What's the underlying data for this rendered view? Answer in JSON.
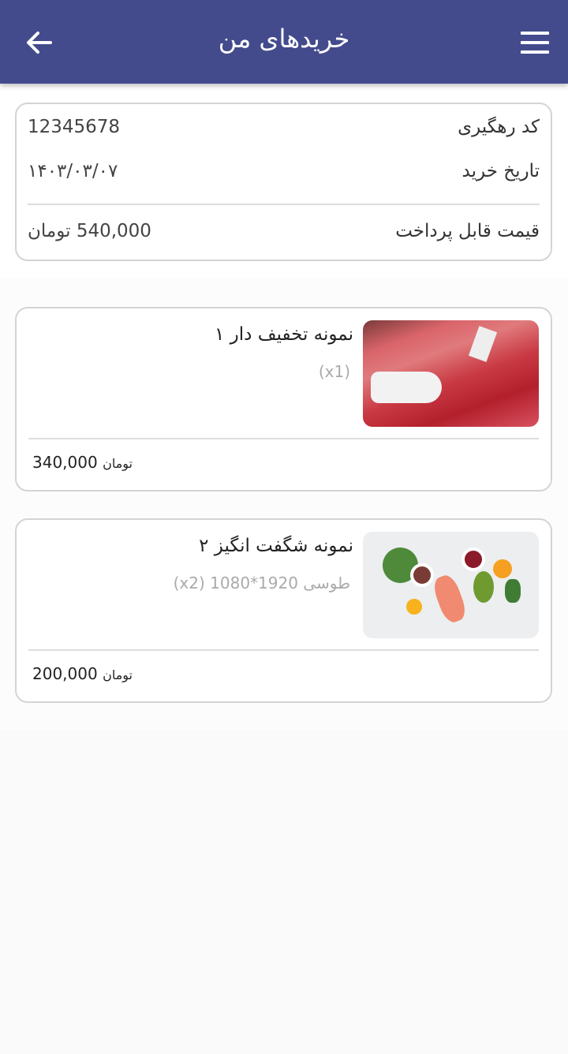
{
  "header": {
    "title": "خریدهای من",
    "back_icon": "arrow-left-icon",
    "menu_icon": "hamburger-menu-icon",
    "color": "#434b8c"
  },
  "order": {
    "tracking_label": "کد رهگیری",
    "tracking_value": "12345678",
    "date_label": "تاریخ خرید",
    "date_value": "۱۴۰۳/۰۳/۰۷",
    "total_label": "قیمت قابل پرداخت",
    "total_value": "540,000 تومان"
  },
  "items": [
    {
      "name": "نمونه تخفیف دار ۱",
      "variant": "(x1)",
      "price": "340,000",
      "currency": "تومان",
      "image": "meat-photo"
    },
    {
      "name": "نمونه شگفت انگیز ۲",
      "variant": "طوسی 1920*1080  (x2)",
      "price": "200,000",
      "currency": "تومان",
      "image": "healthy-food-photo"
    }
  ]
}
